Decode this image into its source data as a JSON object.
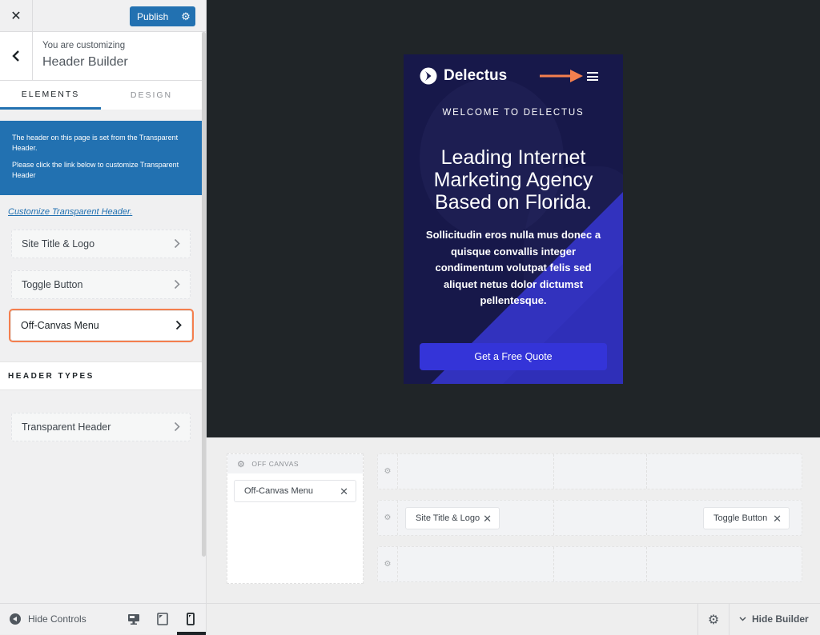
{
  "sidebar": {
    "close_icon": "close-icon",
    "publish_label": "Publish",
    "customizing_small": "You are customizing",
    "customizing_title": "Header Builder",
    "tabs": [
      {
        "label": "ELEMENTS",
        "active": true
      },
      {
        "label": "DESIGN",
        "active": false
      }
    ],
    "notice": {
      "line1": "The header on this page is set from the Transparent Header.",
      "line2": "Please click the link below to customize Transparent Header"
    },
    "customize_link": "Customize Transparent Header.",
    "elements": [
      {
        "label": "Site Title & Logo"
      },
      {
        "label": "Toggle Button"
      },
      {
        "label": "Off-Canvas Menu",
        "highlighted": true
      }
    ],
    "header_types_title": "HEADER TYPES",
    "header_types": [
      {
        "label": "Transparent Header"
      }
    ],
    "footer": {
      "hide_controls": "Hide Controls",
      "devices": [
        "desktop",
        "tablet",
        "mobile"
      ],
      "active_device": "mobile"
    }
  },
  "preview": {
    "brand": "Delectus",
    "welcome": "WELCOME TO DELECTUS",
    "headline_lines": [
      "Leading Internet",
      "Marketing Agency",
      "Based on Florida."
    ],
    "paragraph_lines": [
      "Sollicitudin eros nulla mus donec a",
      "quisque convallis integer",
      "condimentum volutpat felis sed",
      "aliquet netus dolor dictumst",
      "pellentesque."
    ],
    "cta": "Get a Free Quote",
    "accent_arrow_color": "#f47f4e"
  },
  "builder": {
    "offcanvas_title": "OFF CANVAS",
    "offcanvas_items": [
      {
        "label": "Off-Canvas Menu"
      }
    ],
    "rows": [
      {
        "left": "",
        "center": "",
        "right": ""
      },
      {
        "left": "Site Title & Logo",
        "center": "",
        "right": "Toggle Button"
      },
      {
        "left": "",
        "center": "",
        "right": ""
      }
    ],
    "hide_builder": "Hide Builder"
  },
  "colors": {
    "primary": "#2271b1",
    "highlight": "#f47f4e",
    "preview_bg": "#17184a",
    "cta_bg": "#3434d8"
  }
}
